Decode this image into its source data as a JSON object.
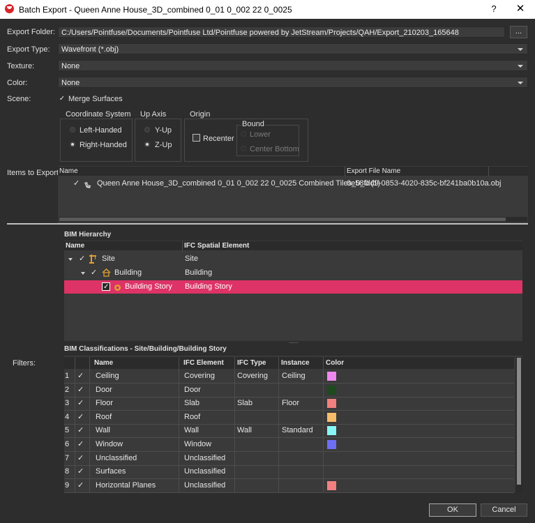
{
  "window": {
    "title": "Batch Export - Queen Anne House_3D_combined 0_01 0_002 22 0_0025",
    "help": "?",
    "close": "✕"
  },
  "export_folder": {
    "label": "Export Folder:",
    "value": "C:/Users/Pointfuse/Documents/Pointfuse Ltd/Pointfuse powered by JetStream/Projects/QAH/Export_210203_165648",
    "browse": "..."
  },
  "export_type": {
    "label": "Export Type:",
    "value": "Wavefront (*.obj)"
  },
  "texture": {
    "label": "Texture:",
    "value": "None"
  },
  "color": {
    "label": "Color:",
    "value": "None"
  },
  "scene": {
    "label": "Scene:",
    "merge_surfaces": "Merge Surfaces",
    "check": "✓",
    "coordinate_system": {
      "title": "Coordinate System",
      "left": "Left-Handed",
      "right": "Right-Handed"
    },
    "up_axis": {
      "title": "Up Axis",
      "y": "Y-Up",
      "z": "Z-Up"
    },
    "origin": {
      "title": "Origin",
      "recenter": "Recenter",
      "bound": "Bound",
      "lower": "Lower",
      "center_bottom": "Center Bottom"
    }
  },
  "items_to_export": {
    "label": "Items to Export:",
    "col_name": "Name",
    "col_file": "Export File Name",
    "check": "✓",
    "row_name": "Queen Anne House_3D_combined 0_01 0_002 22 0_0025 Combined Tiles_0_0 (1)",
    "row_file": "0e58fdd9-0853-4020-835c-bf241ba0b10a.obj"
  },
  "bim_hierarchy": {
    "title": "BIM Hierarchy",
    "col_name": "Name",
    "col_ifc": "IFC Spatial Element",
    "check": "✓",
    "rows": [
      {
        "name": "Site",
        "ifc": "Site"
      },
      {
        "name": "Building",
        "ifc": "Building"
      },
      {
        "name": "Building Story",
        "ifc": "Building Story"
      }
    ],
    "splitter": "......"
  },
  "filters": {
    "label": "Filters:"
  },
  "bim_classifications": {
    "title": "BIM Classifications - Site/Building/Building Story",
    "headers": {
      "name": "Name",
      "ifc_element": "IFC Element",
      "ifc_type": "IFC Type",
      "instance": "Instance",
      "color": "Color"
    },
    "check": "✓",
    "rows": [
      {
        "num": "1",
        "name": "Ceiling",
        "ifc_element": "Covering",
        "ifc_type": "Covering",
        "instance": "Ceiling",
        "color": "#ee88ee"
      },
      {
        "num": "2",
        "name": "Door",
        "ifc_element": "Door",
        "ifc_type": "",
        "instance": "",
        "color": "#1e4a1e"
      },
      {
        "num": "3",
        "name": "Floor",
        "ifc_element": "Slab",
        "ifc_type": "Slab",
        "instance": "Floor",
        "color": "#f28080"
      },
      {
        "num": "4",
        "name": "Roof",
        "ifc_element": "Roof",
        "ifc_type": "",
        "instance": "",
        "color": "#f7bc6a"
      },
      {
        "num": "5",
        "name": "Wall",
        "ifc_element": "Wall",
        "ifc_type": "Wall",
        "instance": "Standard",
        "color": "#86f6f6"
      },
      {
        "num": "6",
        "name": "Window",
        "ifc_element": "Window",
        "ifc_type": "",
        "instance": "",
        "color": "#6e6ef4"
      },
      {
        "num": "7",
        "name": "Unclassified",
        "ifc_element": "Unclassified",
        "ifc_type": "",
        "instance": "",
        "color": ""
      },
      {
        "num": "8",
        "name": "Surfaces",
        "ifc_element": "Unclassified",
        "ifc_type": "",
        "instance": "",
        "color": ""
      },
      {
        "num": "9",
        "name": "Horizontal Planes",
        "ifc_element": "Unclassified",
        "ifc_type": "",
        "instance": "",
        "color": "#f28080"
      }
    ]
  },
  "buttons": {
    "ok": "OK",
    "cancel": "Cancel"
  },
  "colors": {
    "selection": "#dd3366",
    "panel": "#3a3a3a",
    "background": "#2d2d2d"
  }
}
